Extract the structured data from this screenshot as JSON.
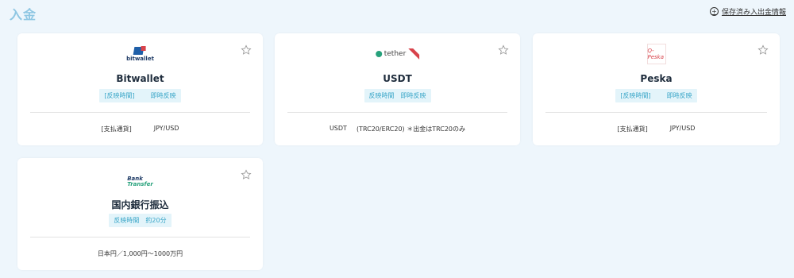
{
  "header": {
    "title": "入金",
    "saved_link": "保存済み入出金情報",
    "plus_glyph": "+"
  },
  "cards": [
    {
      "name": "Bitwallet",
      "logo_text": "bitwallet",
      "tag_left": "[反映時間]",
      "tag_right": "即時反映",
      "info_left": "[支払通貨]",
      "info_right": "JPY/USD"
    },
    {
      "name": "USDT",
      "logo_text": "tether",
      "tag_left": "反映時間",
      "tag_right": "即時反映",
      "info_left": "USDT",
      "info_right": "(TRC20/ERC20) ＊出金はTRC20のみ"
    },
    {
      "name": "Peska",
      "logo_text": "Q-Peska",
      "tag_left": "[反映時間]",
      "tag_right": "即時反映",
      "info_left": "[支払通貨]",
      "info_right": "JPY/USD"
    },
    {
      "name": "国内銀行振込",
      "logo_text_top": "Bank",
      "logo_text_bottom": "Transfer",
      "tag_left": "反映時間",
      "tag_right": "約20分",
      "info_left": "日本円／1,000円〜1000万円",
      "info_right": ""
    }
  ],
  "colors": {
    "background": "#eef6fc",
    "title": "#8fc7e3",
    "tag_bg": "#e3f4fa",
    "tag_text": "#3aa6c8",
    "ribbon": "#d8434b"
  }
}
